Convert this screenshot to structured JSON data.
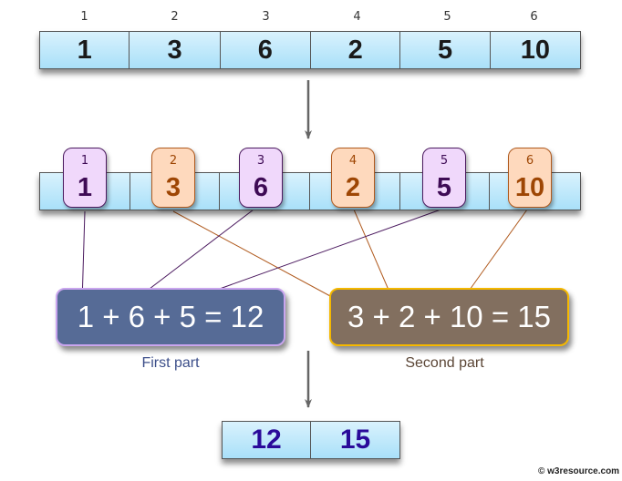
{
  "input_array": {
    "indices": [
      "1",
      "2",
      "3",
      "4",
      "5",
      "6"
    ],
    "values": [
      "1",
      "3",
      "6",
      "2",
      "5",
      "10"
    ]
  },
  "split_cards": [
    {
      "index": "1",
      "value": "1",
      "group": "odd"
    },
    {
      "index": "2",
      "value": "3",
      "group": "even"
    },
    {
      "index": "3",
      "value": "6",
      "group": "odd"
    },
    {
      "index": "4",
      "value": "2",
      "group": "even"
    },
    {
      "index": "5",
      "value": "5",
      "group": "odd"
    },
    {
      "index": "6",
      "value": "10",
      "group": "even"
    }
  ],
  "sums": {
    "first": {
      "expression": "1 + 6 + 5 = 12",
      "caption": "First part"
    },
    "second": {
      "expression": "3 + 2 + 10 = 15",
      "caption": "Second part"
    }
  },
  "result_array": {
    "values": [
      "12",
      "15"
    ]
  },
  "colors": {
    "odd_line": "#4b1a5f",
    "even_line": "#b05a1e",
    "first_box": "#566b96",
    "second_box": "#826f5f",
    "result_text": "#2a0a9a"
  },
  "watermark": "© w3resource.com"
}
